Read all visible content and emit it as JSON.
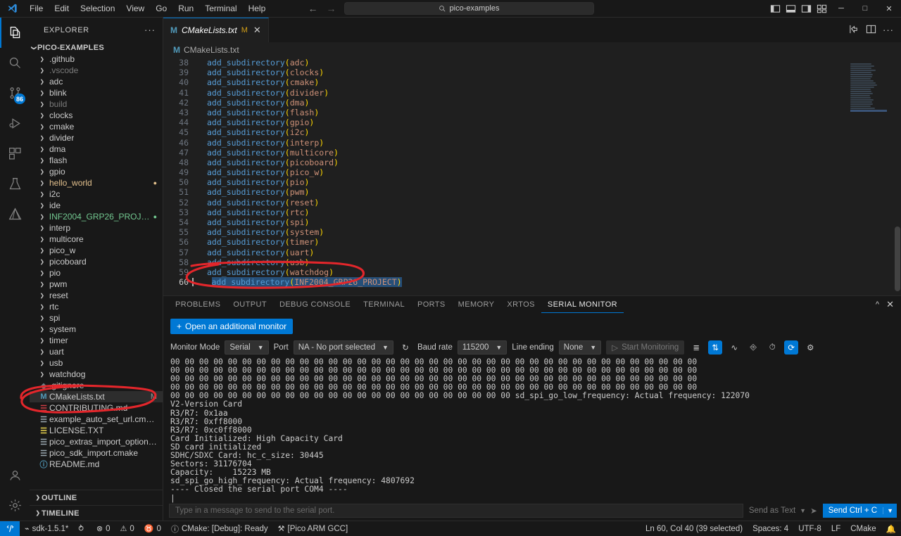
{
  "window": {
    "title": "pico-examples",
    "search_placeholder": "pico-examples",
    "menu": [
      "File",
      "Edit",
      "Selection",
      "View",
      "Go",
      "Run",
      "Terminal",
      "Help"
    ],
    "nav_back": "←",
    "nav_forward": "→",
    "minimize": "─",
    "maximize": "□",
    "close": "✕"
  },
  "activitybar": {
    "items": [
      {
        "name": "explorer",
        "icon": "files-icon",
        "active": true,
        "badge": ""
      },
      {
        "name": "search",
        "icon": "search-icon",
        "active": false,
        "badge": ""
      },
      {
        "name": "source-control",
        "icon": "source-control-icon",
        "active": false,
        "badge": "86"
      },
      {
        "name": "run-and-debug",
        "icon": "run-debug-icon",
        "active": false,
        "badge": ""
      },
      {
        "name": "extensions",
        "icon": "extensions-icon",
        "active": false,
        "badge": ""
      },
      {
        "name": "testing",
        "icon": "beaker-icon",
        "active": false,
        "badge": ""
      },
      {
        "name": "cmake",
        "icon": "cmake-icon",
        "active": false,
        "badge": ""
      }
    ],
    "bottom": [
      {
        "name": "accounts",
        "icon": "account-icon"
      },
      {
        "name": "settings",
        "icon": "gear-icon"
      }
    ]
  },
  "sidebar": {
    "title": "EXPLORER",
    "more_actions": "···",
    "root": "PICO-EXAMPLES",
    "items": [
      {
        "label": ".github",
        "type": "folder",
        "color": "#cccccc"
      },
      {
        "label": ".vscode",
        "type": "folder",
        "color": "#7a7a7a"
      },
      {
        "label": "adc",
        "type": "folder",
        "color": "#cccccc"
      },
      {
        "label": "blink",
        "type": "folder",
        "color": "#cccccc"
      },
      {
        "label": "build",
        "type": "folder",
        "color": "#7a7a7a"
      },
      {
        "label": "clocks",
        "type": "folder",
        "color": "#cccccc"
      },
      {
        "label": "cmake",
        "type": "folder",
        "color": "#cccccc"
      },
      {
        "label": "divider",
        "type": "folder",
        "color": "#cccccc"
      },
      {
        "label": "dma",
        "type": "folder",
        "color": "#cccccc"
      },
      {
        "label": "flash",
        "type": "folder",
        "color": "#cccccc"
      },
      {
        "label": "gpio",
        "type": "folder",
        "color": "#cccccc"
      },
      {
        "label": "hello_world",
        "type": "folder",
        "color": "#e2c08d",
        "dot": "#e2c08d"
      },
      {
        "label": "i2c",
        "type": "folder",
        "color": "#cccccc"
      },
      {
        "label": "ide",
        "type": "folder",
        "color": "#cccccc"
      },
      {
        "label": "INF2004_GRP26_PROJECT",
        "type": "folder",
        "color": "#73c991",
        "dot": "#73c991"
      },
      {
        "label": "interp",
        "type": "folder",
        "color": "#cccccc"
      },
      {
        "label": "multicore",
        "type": "folder",
        "color": "#cccccc"
      },
      {
        "label": "pico_w",
        "type": "folder",
        "color": "#cccccc"
      },
      {
        "label": "picoboard",
        "type": "folder",
        "color": "#cccccc"
      },
      {
        "label": "pio",
        "type": "folder",
        "color": "#cccccc"
      },
      {
        "label": "pwm",
        "type": "folder",
        "color": "#cccccc"
      },
      {
        "label": "reset",
        "type": "folder",
        "color": "#cccccc"
      },
      {
        "label": "rtc",
        "type": "folder",
        "color": "#cccccc"
      },
      {
        "label": "spi",
        "type": "folder",
        "color": "#cccccc"
      },
      {
        "label": "system",
        "type": "folder",
        "color": "#cccccc"
      },
      {
        "label": "timer",
        "type": "folder",
        "color": "#cccccc"
      },
      {
        "label": "uart",
        "type": "folder",
        "color": "#cccccc"
      },
      {
        "label": "usb",
        "type": "folder",
        "color": "#cccccc"
      },
      {
        "label": "watchdog",
        "type": "folder",
        "color": "#cccccc"
      },
      {
        "label": ".gitignore",
        "type": "file",
        "icon": "git-icon",
        "icon_color": "#6d8086",
        "glyph": "◆",
        "color": "#cccccc"
      },
      {
        "label": "CMakeLists.txt",
        "type": "file",
        "icon": "cmake-file-icon",
        "icon_color": "#519aba",
        "glyph": "M",
        "color": "#cccccc",
        "selected": true,
        "git_status": "M"
      },
      {
        "label": "CONTRIBUTING.md",
        "type": "file",
        "icon": "markdown-icon",
        "icon_color": "#cc3e44",
        "glyph": "☰",
        "color": "#cccccc"
      },
      {
        "label": "example_auto_set_url.cmake",
        "type": "file",
        "icon": "cmake-file-icon",
        "icon_color": "#9aa7b0",
        "glyph": "☰",
        "color": "#cccccc"
      },
      {
        "label": "LICENSE.TXT",
        "type": "file",
        "icon": "license-icon",
        "icon_color": "#e6d14e",
        "glyph": "☰",
        "color": "#cccccc"
      },
      {
        "label": "pico_extras_import_optional.cmake",
        "type": "file",
        "icon": "cmake-file-icon",
        "icon_color": "#9aa7b0",
        "glyph": "☰",
        "color": "#cccccc"
      },
      {
        "label": "pico_sdk_import.cmake",
        "type": "file",
        "icon": "cmake-file-icon",
        "icon_color": "#9aa7b0",
        "glyph": "☰",
        "color": "#cccccc"
      },
      {
        "label": "README.md",
        "type": "file",
        "icon": "info-icon",
        "icon_color": "#519aba",
        "glyph": "ⓘ",
        "color": "#cccccc"
      }
    ],
    "sections": [
      "OUTLINE",
      "TIMELINE"
    ]
  },
  "editor": {
    "tab": {
      "icon_glyph": "M",
      "name": "CMakeLists.txt",
      "modified_badge": "M",
      "close_glyph": "✕"
    },
    "breadcrumb": {
      "icon_glyph": "M",
      "text": "CMakeLists.txt"
    },
    "tab_actions": [
      "split-editor-icon",
      "more-actions-icon"
    ],
    "lines": [
      {
        "n": 38,
        "fn": "add_subdirectory",
        "arg": "adc"
      },
      {
        "n": 39,
        "fn": "add_subdirectory",
        "arg": "clocks"
      },
      {
        "n": 40,
        "fn": "add_subdirectory",
        "arg": "cmake"
      },
      {
        "n": 41,
        "fn": "add_subdirectory",
        "arg": "divider"
      },
      {
        "n": 42,
        "fn": "add_subdirectory",
        "arg": "dma"
      },
      {
        "n": 43,
        "fn": "add_subdirectory",
        "arg": "flash"
      },
      {
        "n": 44,
        "fn": "add_subdirectory",
        "arg": "gpio"
      },
      {
        "n": 45,
        "fn": "add_subdirectory",
        "arg": "i2c"
      },
      {
        "n": 46,
        "fn": "add_subdirectory",
        "arg": "interp"
      },
      {
        "n": 47,
        "fn": "add_subdirectory",
        "arg": "multicore"
      },
      {
        "n": 48,
        "fn": "add_subdirectory",
        "arg": "picoboard"
      },
      {
        "n": 49,
        "fn": "add_subdirectory",
        "arg": "pico_w"
      },
      {
        "n": 50,
        "fn": "add_subdirectory",
        "arg": "pio"
      },
      {
        "n": 51,
        "fn": "add_subdirectory",
        "arg": "pwm"
      },
      {
        "n": 52,
        "fn": "add_subdirectory",
        "arg": "reset"
      },
      {
        "n": 53,
        "fn": "add_subdirectory",
        "arg": "rtc"
      },
      {
        "n": 54,
        "fn": "add_subdirectory",
        "arg": "spi"
      },
      {
        "n": 55,
        "fn": "add_subdirectory",
        "arg": "system"
      },
      {
        "n": 56,
        "fn": "add_subdirectory",
        "arg": "timer"
      },
      {
        "n": 57,
        "fn": "add_subdirectory",
        "arg": "uart"
      },
      {
        "n": 58,
        "fn": "add_subdirectory",
        "arg": "usb"
      },
      {
        "n": 59,
        "fn": "add_subdirectory",
        "arg": "watchdog"
      },
      {
        "n": 60,
        "fn": "add_subdirectory",
        "arg": "INF2004_GRP26_PROJECT",
        "selected": true
      }
    ]
  },
  "panel": {
    "tabs": [
      {
        "label": "PROBLEMS",
        "active": false
      },
      {
        "label": "OUTPUT",
        "active": false
      },
      {
        "label": "DEBUG CONSOLE",
        "active": false
      },
      {
        "label": "TERMINAL",
        "active": false
      },
      {
        "label": "PORTS",
        "active": false
      },
      {
        "label": "MEMORY",
        "active": false
      },
      {
        "label": "XRTOS",
        "active": false
      },
      {
        "label": "SERIAL MONITOR",
        "active": true
      }
    ],
    "actions": [
      "chevron-up-icon",
      "close-icon"
    ],
    "open_additional_monitor": "Open an additional monitor",
    "open_additional_plus": "+",
    "toolbar": {
      "monitor_mode_label": "Monitor Mode",
      "monitor_mode_value": "Serial",
      "port_label": "Port",
      "port_value": "NA - No port selected",
      "refresh_icon": "refresh-icon",
      "baud_label": "Baud rate",
      "baud_value": "115200",
      "line_ending_label": "Line ending",
      "line_ending_value": "None",
      "start_monitoring": "Start Monitoring",
      "start_glyph": "▷",
      "icons": [
        {
          "name": "clear-output-icon",
          "glyph": "≣",
          "on": false
        },
        {
          "name": "toggle-line-wrap-icon",
          "glyph": "⇋",
          "on": true
        },
        {
          "name": "toggle-hex-icon",
          "glyph": "∂",
          "on": false
        },
        {
          "name": "open-in-editor-icon",
          "glyph": "⥅",
          "on": false
        },
        {
          "name": "timestamp-icon",
          "glyph": "◴",
          "on": false
        },
        {
          "name": "auto-reconnect-icon",
          "glyph": "⟳",
          "on": true
        },
        {
          "name": "gear-icon",
          "glyph": "⚙",
          "on": false
        }
      ]
    },
    "output_lines": [
      "00 00 00 00 00 00 00 00 00 00 00 00 00 00 00 00 00 00 00 00 00 00 00 00 00 00 00 00 00 00 00 00 00 00 00 00 00",
      "00 00 00 00 00 00 00 00 00 00 00 00 00 00 00 00 00 00 00 00 00 00 00 00 00 00 00 00 00 00 00 00 00 00 00 00 00",
      "00 00 00 00 00 00 00 00 00 00 00 00 00 00 00 00 00 00 00 00 00 00 00 00 00 00 00 00 00 00 00 00 00 00 00 00 00",
      "00 00 00 00 00 00 00 00 00 00 00 00 00 00 00 00 00 00 00 00 00 00 00 00 00 00 00 00 00 00 00 00 00 00 00 00 00",
      "00 00 00 00 00 00 00 00 00 00 00 00 00 00 00 00 00 00 00 00 00 00 00 00 sd_spi_go_low_frequency: Actual frequency: 122070",
      "V2-Version Card",
      "R3/R7: 0x1aa",
      "R3/R7: 0xff8000",
      "R3/R7: 0xc0ff8000",
      "Card Initialized: High Capacity Card",
      "SD card initialized",
      "SDHC/SDXC Card: hc_c_size: 30445",
      "Sectors: 31176704",
      "Capacity:    15223 MB",
      "sd_spi_go_high_frequency: Actual frequency: 4807692",
      "---- Closed the serial port COM4 ----"
    ],
    "send": {
      "placeholder": "Type in a message to send to the serial port.",
      "send_as_text": "Send as Text",
      "send_glyph": "➤",
      "send_ctrl_c": "Send Ctrl + C",
      "chevron": "⌄"
    }
  },
  "statusbar": {
    "remote_icon": "remote-window-icon",
    "left": [
      {
        "name": "sdk-version",
        "icon": "⌁",
        "label": "sdk-1.5.1*"
      },
      {
        "name": "sync-changes",
        "icon": "⥁",
        "label": ""
      },
      {
        "name": "errors",
        "icon": "⊗",
        "label": "0"
      },
      {
        "name": "warnings",
        "icon": "⚠",
        "label": "0"
      },
      {
        "name": "ports",
        "icon": "♉",
        "label": "0"
      },
      {
        "name": "cmake-status",
        "icon": "ⓘ",
        "label": "CMake: [Debug]: Ready"
      },
      {
        "name": "kit",
        "icon": "⚒",
        "label": "[Pico ARM GCC]"
      }
    ],
    "right": [
      {
        "name": "cursor-position",
        "label": "Ln 60, Col 40 (39 selected)"
      },
      {
        "name": "indentation",
        "label": "Spaces: 4"
      },
      {
        "name": "encoding",
        "label": "UTF-8"
      },
      {
        "name": "eol",
        "label": "LF"
      },
      {
        "name": "language-mode",
        "label": "CMake"
      },
      {
        "name": "notifications",
        "label": "🔔"
      }
    ]
  },
  "annotations": {
    "accent": "#e3262b",
    "shapes": [
      "ellipse-around-cmakelists-sidebar",
      "ellipse-around-line60"
    ]
  }
}
